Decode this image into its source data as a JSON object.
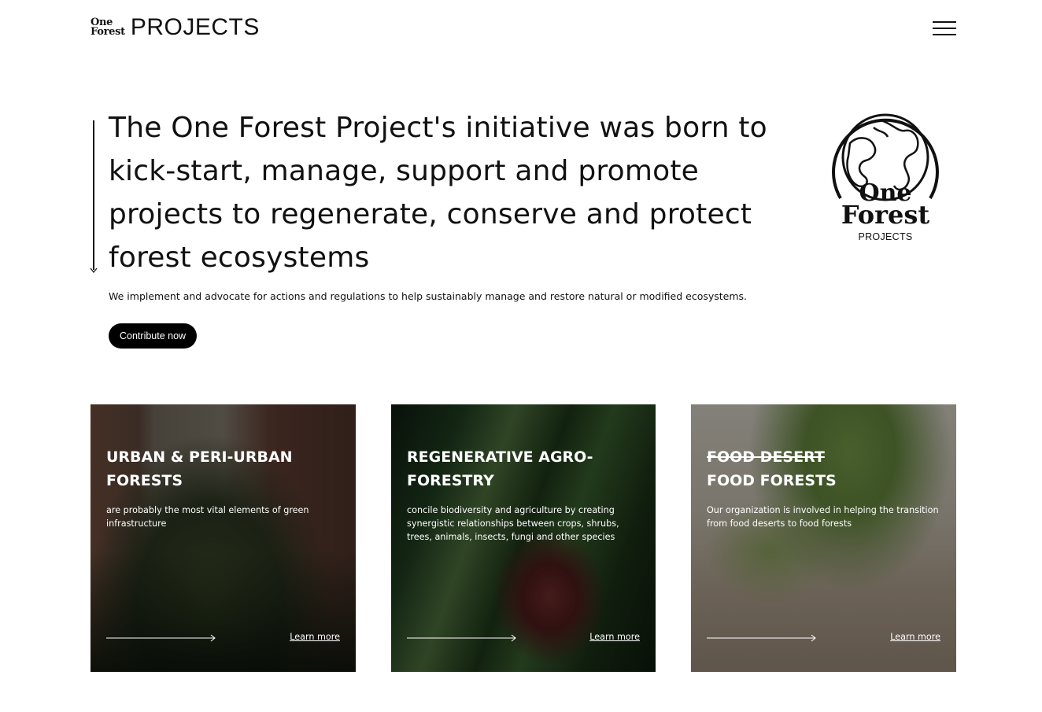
{
  "header": {
    "logo_mark_line1": "One",
    "logo_mark_line2": "Forest",
    "logo_text": "PROJECTS",
    "menu_icon": "hamburger-menu-icon"
  },
  "hero": {
    "title": "The One Forest Project's initiative was born to kick-start, manage, support and promote projects to regenerate, conserve and protect forest ecosystems",
    "subtitle": "We implement and advocate for actions and regulations to help sustainably manage and restore natural or modified ecosystems.",
    "cta_label": "Contribute now",
    "scroll_icon": "arrow-down-icon"
  },
  "big_logo": {
    "icon": "globe-icon",
    "line1": "One",
    "line2": "Forest",
    "line3": "PROJECTS"
  },
  "cards": [
    {
      "title": "URBAN & PERI-URBAN FORESTS",
      "text": "are probably the most vital elements of green infrastructure",
      "link": "Learn more",
      "image": "city-forest-photo"
    },
    {
      "title": "REGENERATIVE AGRO-FORESTRY",
      "text": "concile biodiversity and agriculture by creating synergistic relationships between crops, shrubs, trees, animals, insects, fungi and other species",
      "link": "Learn more",
      "image": "plant-closeup-photo"
    },
    {
      "title_struck": "FOOD DESERT",
      "title": "FOOD FORESTS",
      "text": "Our organization is involved in helping  the transition from food deserts to food forests",
      "link": "Learn more",
      "image": "papaya-trees-photo"
    }
  ],
  "colors": {
    "text": "#111111",
    "button_bg": "#000000",
    "button_text": "#ffffff"
  }
}
